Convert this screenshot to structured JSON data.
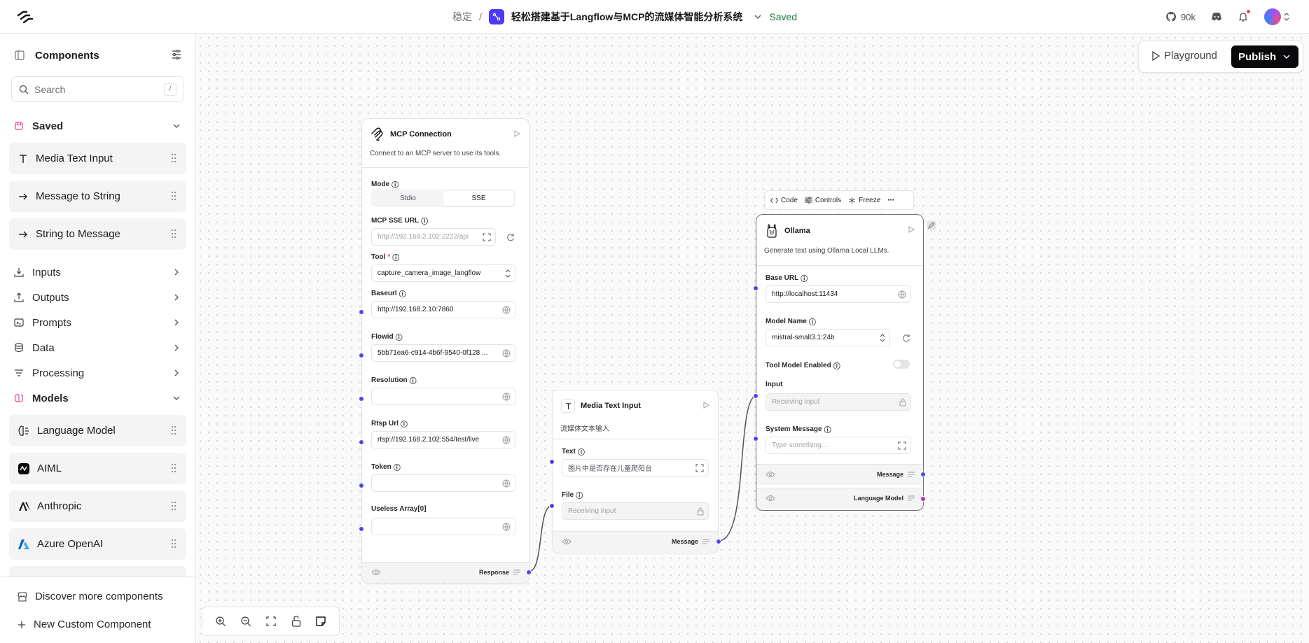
{
  "topbar": {
    "folder": "稳定",
    "separator": "/",
    "project_name": "轻松搭建基于Langflow与MCP的流媒体智能分析系统",
    "save_status": "Saved",
    "github_stars": "90k"
  },
  "sidebar": {
    "title": "Components",
    "search_placeholder": "Search",
    "search_shortcut": "/",
    "saved_label": "Saved",
    "saved_items": [
      {
        "label": "Media Text Input"
      },
      {
        "label": "Message to String"
      },
      {
        "label": "String to Message"
      }
    ],
    "categories": [
      {
        "label": "Inputs"
      },
      {
        "label": "Outputs"
      },
      {
        "label": "Prompts"
      },
      {
        "label": "Data"
      },
      {
        "label": "Processing"
      }
    ],
    "models_label": "Models",
    "model_items": [
      {
        "label": "Language Model"
      },
      {
        "label": "AIML"
      },
      {
        "label": "Anthropic"
      },
      {
        "label": "Azure OpenAI"
      }
    ],
    "discover_label": "Discover more components",
    "new_custom_label": "New Custom Component"
  },
  "canvas": {
    "playground_label": "Playground",
    "publish_label": "Publish"
  },
  "mcp_node": {
    "title": "MCP Connection",
    "description": "Connect to an MCP server to use its tools.",
    "mode_label": "Mode",
    "mode_options": [
      "Stdio",
      "SSE"
    ],
    "mode_selected": "SSE",
    "sse_url_label": "MCP SSE URL",
    "sse_url_value": "http://192.168.2.102:2222/api",
    "tool_label": "Tool",
    "tool_required": "*",
    "tool_value": "capture_camera_image_langflow",
    "baseurl_label": "Baseurl",
    "baseurl_value": "http://192.168.2.10:7860",
    "flowid_label": "Flowid",
    "flowid_value": "5bb71ea6-c914-4b6f-9540-0f128 ...",
    "resolution_label": "Resolution",
    "resolution_value": "",
    "rtsp_label": "Rtsp Url",
    "rtsp_value": "rtsp://192.168.2.102:554/test/live",
    "token_label": "Token",
    "token_value": "",
    "array_label": "Useless Array[0]",
    "array_value": "",
    "output_label": "Response"
  },
  "media_node": {
    "title": "Media Text Input",
    "description": "流媒体文本输入",
    "text_label": "Text",
    "text_value": "图片中是否存在儿童爬阳台",
    "file_label": "File",
    "file_placeholder": "Receiving input",
    "output_label": "Message"
  },
  "ollama_node": {
    "toolbar": {
      "code": "Code",
      "controls": "Controls",
      "freeze": "Freeze"
    },
    "title": "Ollama",
    "description": "Generate text using Ollama Local LLMs.",
    "base_url_label": "Base URL",
    "base_url_value": "http://localhost:11434",
    "model_name_label": "Model Name",
    "model_name_value": "mistral-small3.1:24b",
    "tool_model_label": "Tool Model Enabled",
    "tool_model_enabled": false,
    "input_label": "Input",
    "input_placeholder": "Receiving input",
    "system_message_label": "System Message",
    "system_message_placeholder": "Type something...",
    "output_message_label": "Message",
    "output_lm_label": "Language Model"
  },
  "colors": {
    "accent": "#4f39f6",
    "saved_green": "#15803d",
    "handle_blue": "#4f46e5",
    "handle_pink": "#c026d3"
  }
}
